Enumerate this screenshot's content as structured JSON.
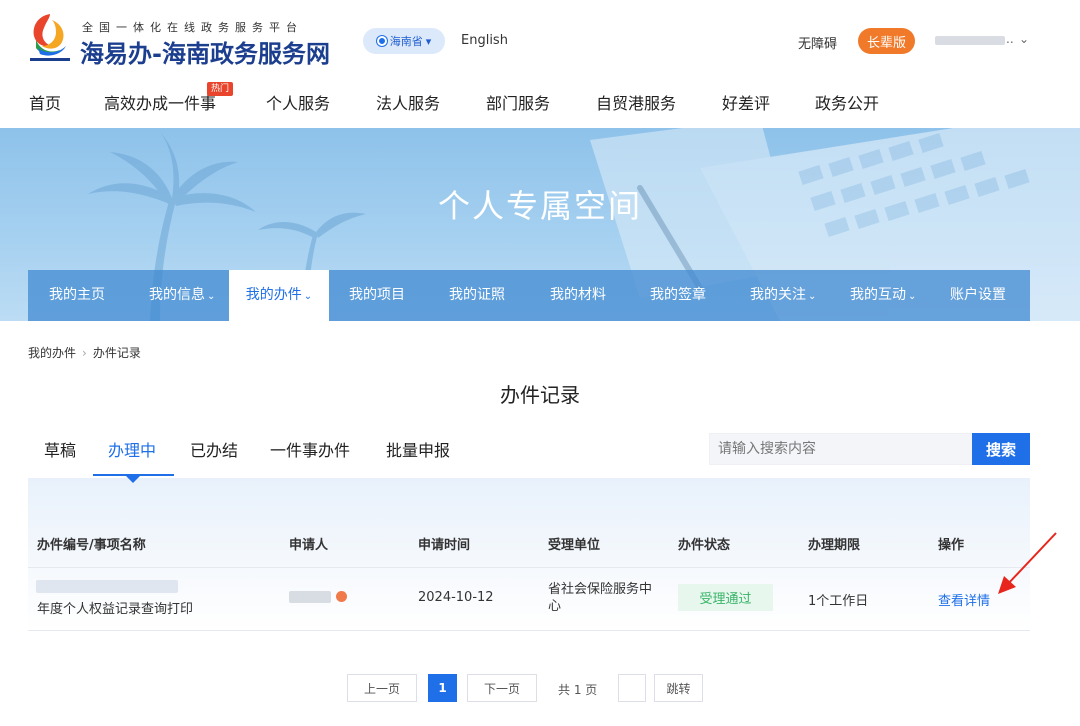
{
  "header": {
    "tagline": "全国一体化在线政务服务平台",
    "site_title": "海易办-海南政务服务网",
    "region": "海南省",
    "region_chevron": "▾",
    "lang": "English",
    "accessibility": "无障碍",
    "elder_mode": "长辈版",
    "user_dots": "..",
    "user_chevron": "⌄",
    "hot_badge": "热门"
  },
  "main_nav": [
    {
      "label": "首页"
    },
    {
      "label": "高效办成一件事"
    },
    {
      "label": "个人服务"
    },
    {
      "label": "法人服务"
    },
    {
      "label": "部门服务"
    },
    {
      "label": "自贸港服务"
    },
    {
      "label": "好差评"
    },
    {
      "label": "政务公开"
    }
  ],
  "banner": {
    "title": "个人专属空间"
  },
  "sub_nav": [
    {
      "label": "我的主页",
      "chev": ""
    },
    {
      "label": "我的信息",
      "chev": "⌄"
    },
    {
      "label": "我的办件",
      "chev": "⌄"
    },
    {
      "label": "我的项目",
      "chev": ""
    },
    {
      "label": "我的证照",
      "chev": ""
    },
    {
      "label": "我的材料",
      "chev": ""
    },
    {
      "label": "我的签章",
      "chev": ""
    },
    {
      "label": "我的关注",
      "chev": "⌄"
    },
    {
      "label": "我的互动",
      "chev": "⌄"
    },
    {
      "label": "账户设置",
      "chev": ""
    }
  ],
  "breadcrumb": {
    "root": "我的办件",
    "sep": "›",
    "current": "办件记录"
  },
  "page_title": "办件记录",
  "tabs": [
    {
      "label": "草稿"
    },
    {
      "label": "办理中"
    },
    {
      "label": "已办结"
    },
    {
      "label": "一件事办件"
    },
    {
      "label": "批量申报"
    }
  ],
  "search": {
    "placeholder": "请输入搜索内容",
    "button": "搜索"
  },
  "table": {
    "headers": [
      "办件编号/事项名称",
      "申请人",
      "申请时间",
      "受理单位",
      "办件状态",
      "办理期限",
      "操作"
    ],
    "rows": [
      {
        "item_name": "年度个人权益记录查询打印",
        "date": "2024-10-12",
        "unit_line1": "省社会保险服务中",
        "unit_line2": "心",
        "status": "受理通过",
        "deadline": "1个工作日",
        "action": "查看详情"
      }
    ]
  },
  "pagination": {
    "prev": "上一页",
    "current": "1",
    "next": "下一页",
    "total": "共 1 页",
    "jump": "跳转"
  },
  "colors": {
    "primary": "#1f6fe8",
    "elder": "#f07a2a",
    "status_green": "#38b468",
    "annotation": "#e8251c"
  }
}
